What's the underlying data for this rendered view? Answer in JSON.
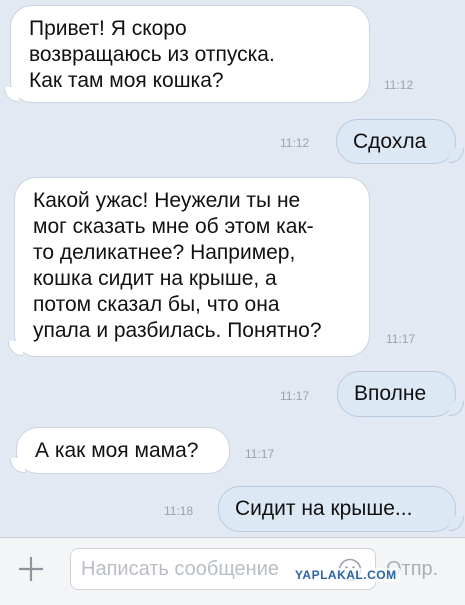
{
  "messages": [
    {
      "dir": "in",
      "text": "Привет! Я скоро\nвозвращаюсь из отпуска.\nКак там моя кошка?",
      "time": "11:12"
    },
    {
      "dir": "out",
      "text": "Сдохла",
      "time": "11:12"
    },
    {
      "dir": "in",
      "text": "Какой ужас! Неужели ты не\nмог сказать мне об этом как-\nто деликатнее? Например,\nкошка сидит на крыше, а\nпотом сказал бы, что она\nупала и разбилась. Понятно?",
      "time": "11:17"
    },
    {
      "dir": "out",
      "text": "Вполне",
      "time": "11:17"
    },
    {
      "dir": "in",
      "text": "А как моя мама?",
      "time": "11:17"
    },
    {
      "dir": "out",
      "text": "Сидит на крыше...",
      "time": "11:18"
    }
  ],
  "input_bar": {
    "attach_icon": "plus-icon",
    "placeholder": "Написать сообщение",
    "smiley_icon": "smiley-icon",
    "send_label": "Отпр."
  },
  "watermark": "YAPLAKAL.COM",
  "colors": {
    "background": "#e3e9f2",
    "incoming_bubble": "#ffffff",
    "outgoing_bubble": "#dde8f5",
    "timestamp": "#9aa3ae"
  }
}
